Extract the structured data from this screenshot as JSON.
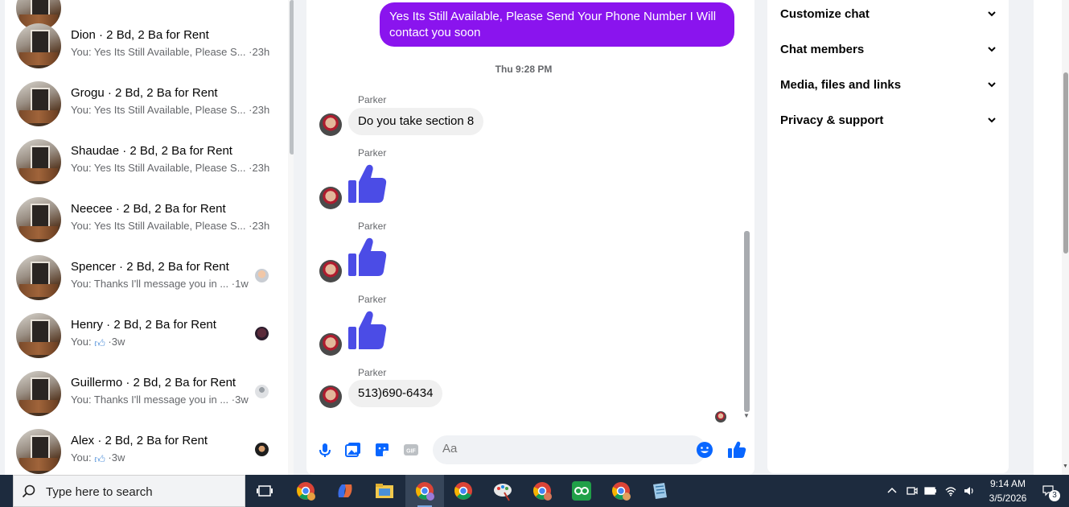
{
  "conversations": [
    {
      "name": "Dion · 2 Bd, 2 Ba for Rent",
      "preview": "You: Yes Its Still Available, Please S...",
      "time": "·23h"
    },
    {
      "name": "Grogu · 2 Bd, 2 Ba for Rent",
      "preview": "You: Yes Its Still Available, Please S...",
      "time": "·23h"
    },
    {
      "name": "Shaudae · 2 Bd, 2 Ba for Rent",
      "preview": "You: Yes Its Still Available, Please S...",
      "time": "·23h"
    },
    {
      "name": "Neecee · 2 Bd, 2 Ba for Rent",
      "preview": "You: Yes Its Still Available, Please S...",
      "time": "·23h"
    },
    {
      "name": "Spencer · 2 Bd, 2 Ba for Rent",
      "preview": "You: Thanks I'll message you in ...",
      "time": "·1w"
    },
    {
      "name": "Henry · 2 Bd, 2 Ba for Rent",
      "preview": "You:",
      "time": "·3w"
    },
    {
      "name": "Guillermo · 2 Bd, 2 Ba for Rent",
      "preview": "You: Thanks I'll message you in ...",
      "time": "·3w"
    },
    {
      "name": "Alex · 2 Bd, 2 Ba for Rent",
      "preview": "You:",
      "time": "·3w"
    }
  ],
  "chat": {
    "outgoing_message": "Yes Its Still Available, Please Send Your Phone Number I Will contact you soon",
    "time_separator": "Thu 9:28 PM",
    "sender": "Parker",
    "message_section8": "Do you take section 8",
    "message_phone": "513)690-6434",
    "composer_placeholder": "Aa"
  },
  "details": {
    "items": [
      "Customize chat",
      "Chat members",
      "Media, files and links",
      "Privacy & support"
    ]
  },
  "taskbar": {
    "search_placeholder": "Type here to search",
    "time": "9:14 AM",
    "date": "3/5/2026",
    "notification_count": "3"
  },
  "colors": {
    "outgoing_bubble": "#8a14ee",
    "like_blue": "#0866ff",
    "thumb_purple": "#4b4ce6",
    "taskbar": "#1d2b3e"
  }
}
